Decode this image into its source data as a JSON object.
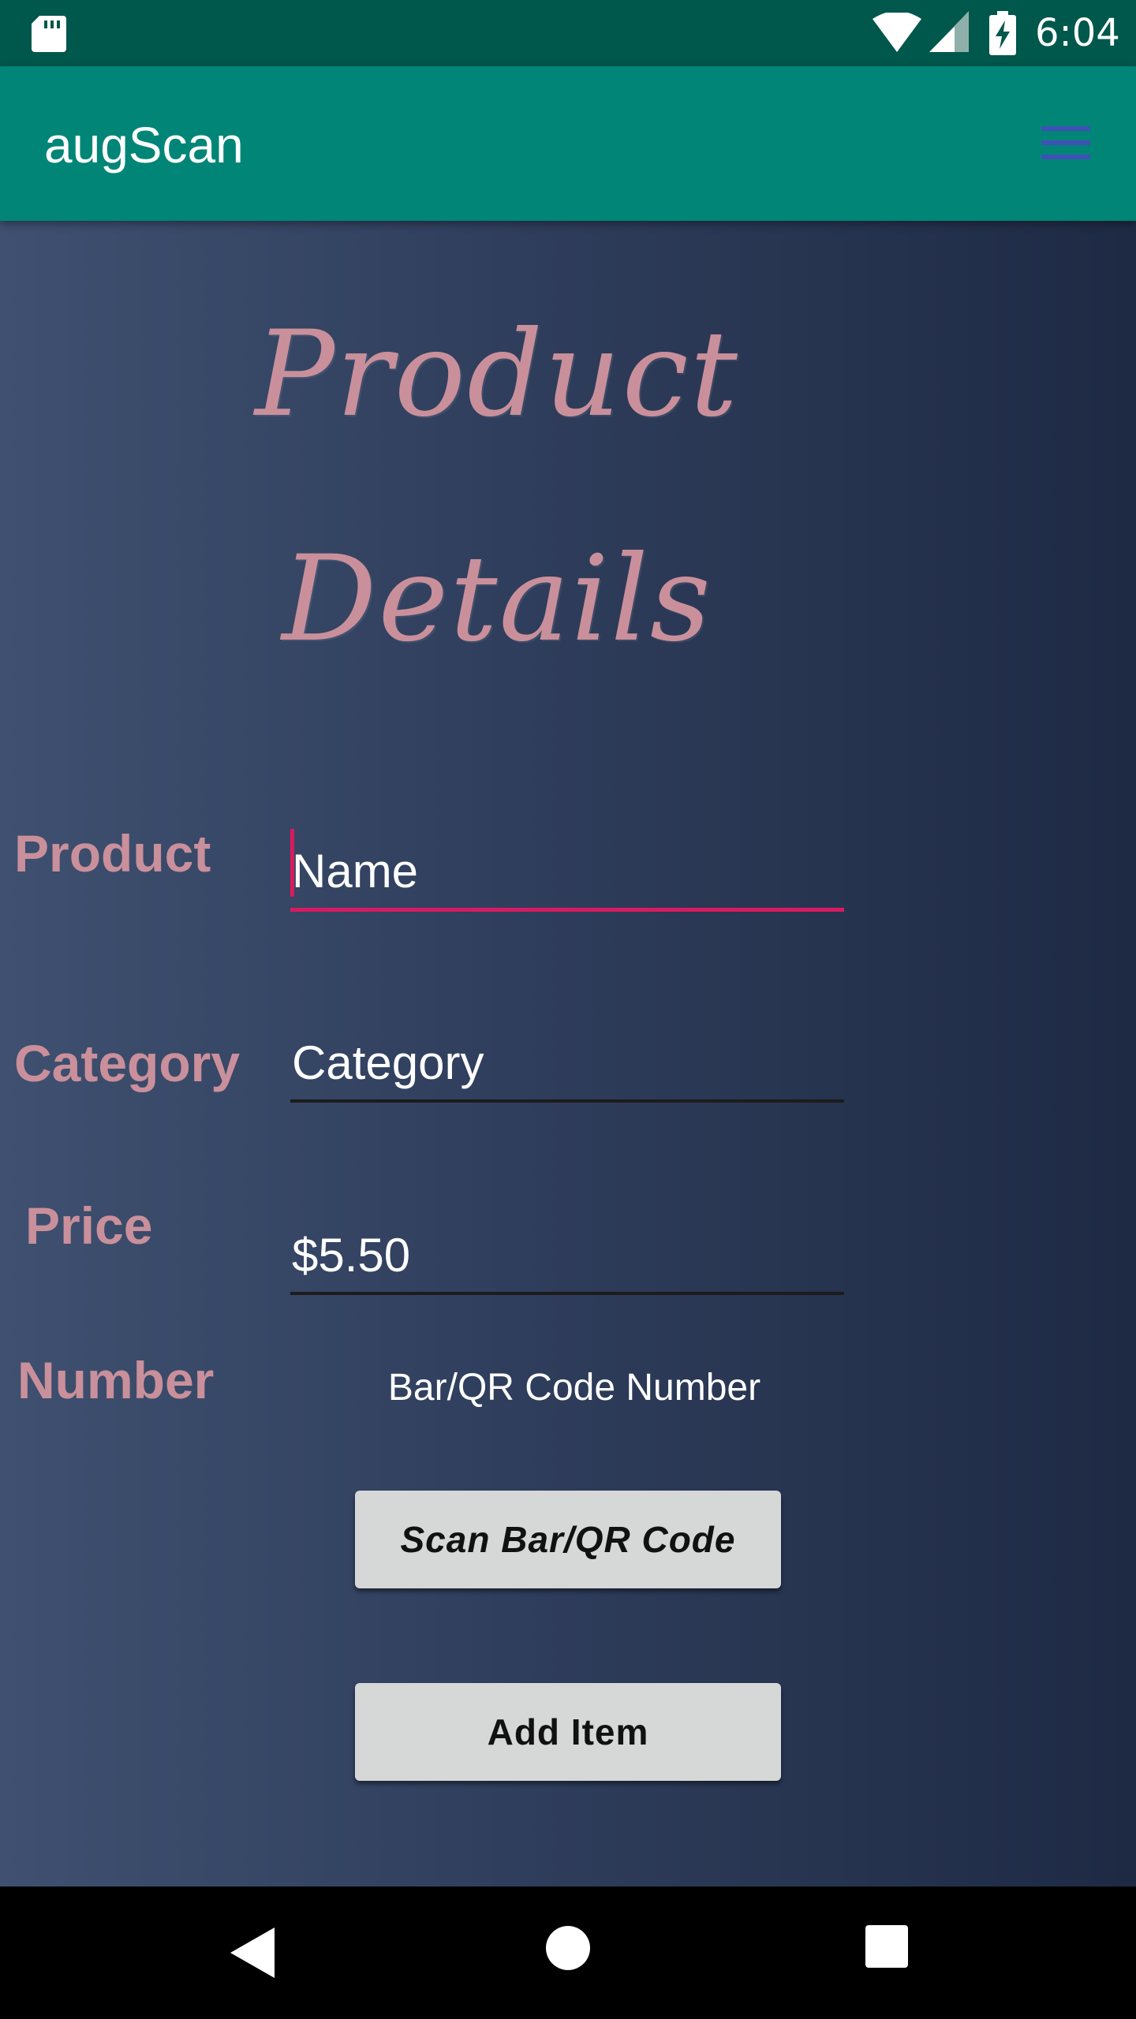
{
  "status_bar": {
    "time": "6:04",
    "icons": [
      "sd-card-icon",
      "wifi-icon",
      "signal-icon",
      "battery-charging-icon"
    ]
  },
  "app_bar": {
    "title": "augScan",
    "menu_icon": "hamburger-menu-icon"
  },
  "colors": {
    "status_bar": "#00574b",
    "app_bar": "#008577",
    "accent": "#d81b60",
    "label": "#c9909b",
    "button": "#d6d7d7"
  },
  "heading": {
    "line1": "Product",
    "line2": "Details"
  },
  "form": {
    "product_label": "Product",
    "product_value": "Name",
    "category_label": "Category",
    "category_value": "Category",
    "price_label": "Price",
    "price_value": "$5.50",
    "number_label": "Number",
    "number_value": "Bar/QR Code Number"
  },
  "buttons": {
    "scan_label": "Scan Bar/QR Code",
    "add_label": "Add Item"
  },
  "nav_bar": {
    "icons": [
      "back-icon",
      "home-icon",
      "recent-apps-icon"
    ]
  }
}
